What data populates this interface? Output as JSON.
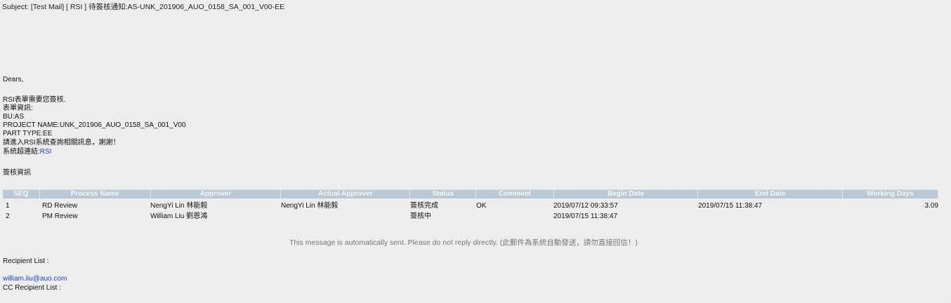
{
  "subject": "Subject: [Test Mail] [ RSI ] 待簽核通知:AS-UNK_201906_AUO_0158_SA_001_V00-EE",
  "body": {
    "greeting": "Dears,",
    "intro": "RSI表單需要您簽核.",
    "form_info_label": "表單資訊:",
    "bu": "BU:AS",
    "project_name": "PROJECT NAME:UNK_201906_AUO_0158_SA_001_V00",
    "part_type": "PART TYPE:EE",
    "instruction": "請進入RSI系統查詢相關訊息，謝謝！",
    "system_link_label": "系統超連結:",
    "system_link_text": "RSI",
    "review_info_label": "簽核資訊"
  },
  "table": {
    "headers": [
      "SEQ",
      "Process Name",
      "Approver",
      "Actual Approver",
      "Status",
      "Comment",
      "Begin Date",
      "End Date",
      "Working Days"
    ],
    "rows": [
      [
        "1",
        "RD Review",
        "NengYi Lin 林能毅",
        "NengYi Lin 林能毅",
        "簽核完成",
        "OK",
        "2019/07/12 09:33:57",
        "2019/07/15 11:38:47",
        "3.09"
      ],
      [
        "2",
        "PM Review",
        "William Liu 劉恩鴻",
        "",
        "簽核中",
        "",
        "2019/07/15 11:38:47",
        "",
        ""
      ]
    ]
  },
  "notice": "This message is automatically sent. Please do not reply directly. (此郵件為系統自動發送，請勿直接回信！)",
  "recipients": {
    "label": "Recipient List :",
    "email": "william.liu@auo.com",
    "cc_label": "CC Recipient List :"
  },
  "colors": {
    "header_bg": "#b9c9d6",
    "link": "#1a3fd6"
  }
}
